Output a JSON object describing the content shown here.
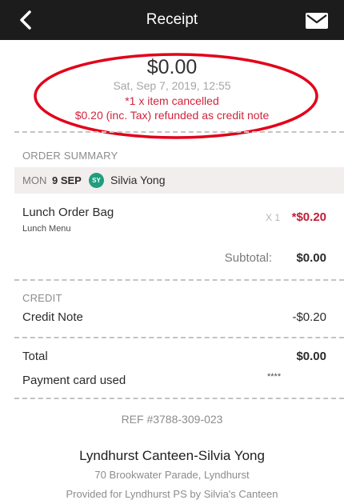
{
  "header": {
    "title": "Receipt"
  },
  "summary": {
    "amount": "$0.00",
    "datetime": "Sat, Sep 7, 2019, 12:55",
    "cancel_note": "*1 x item cancelled",
    "refund_note": "$0.20 (inc. Tax) refunded as credit note"
  },
  "order_summary": {
    "heading": "ORDER SUMMARY",
    "day": "MON",
    "date": "9 SEP",
    "avatar_initials": "SY",
    "person": "Silvia Yong",
    "item_name": "Lunch Order Bag",
    "item_menu": "Lunch Menu",
    "item_qty": "X 1",
    "item_price": "*$0.20",
    "subtotal_label": "Subtotal:",
    "subtotal_value": "$0.00"
  },
  "credit": {
    "heading": "CREDIT",
    "label": "Credit Note",
    "value": "-$0.20"
  },
  "totals": {
    "total_label": "Total",
    "total_value": "$0.00",
    "payment_label": "Payment card used",
    "payment_value": "****"
  },
  "footer": {
    "ref": "REF #3788-309-023",
    "canteen_name": "Lyndhurst Canteen-Silvia Yong",
    "address": "70 Brookwater Parade, Lyndhurst",
    "provided_by": "Provided for Lyndhurst PS by Silvia's Canteen"
  },
  "colors": {
    "header_bg": "#1c1c1c",
    "accent_red": "#d0243c",
    "avatar_green": "#1f9e7e"
  }
}
